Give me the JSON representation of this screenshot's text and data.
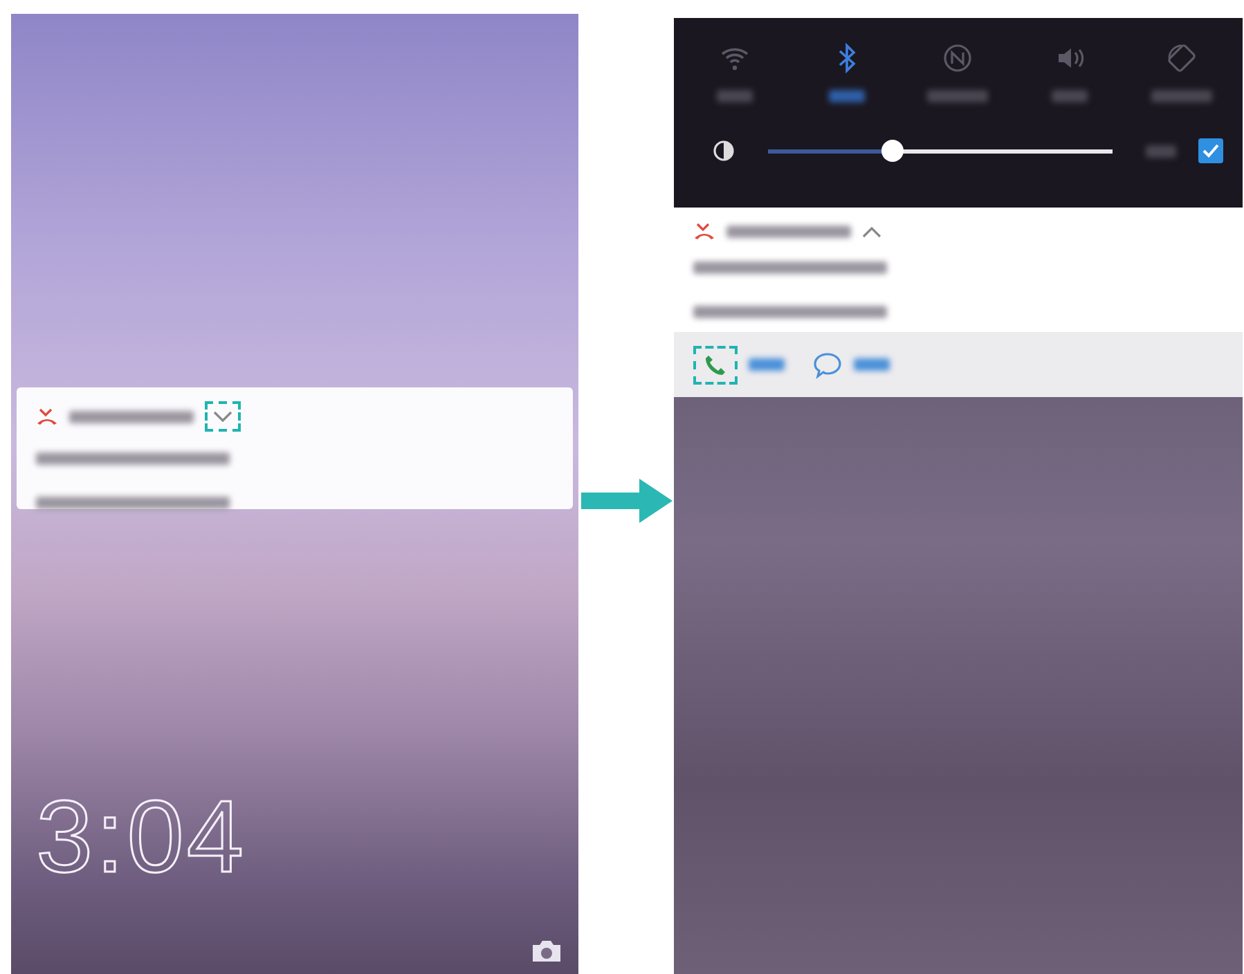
{
  "lock_screen": {
    "clock": "3:04",
    "notification": {
      "expanded": false
    }
  },
  "notification_shade": {
    "toggles": [
      {
        "kind": "wifi",
        "on": false
      },
      {
        "kind": "bluetooth",
        "on": true
      },
      {
        "kind": "nfc",
        "on": false
      },
      {
        "kind": "sound",
        "on": false
      },
      {
        "kind": "rotation",
        "on": false
      }
    ],
    "brightness": {
      "level": 0.36,
      "auto": true
    },
    "notification": {
      "expanded": true
    }
  }
}
